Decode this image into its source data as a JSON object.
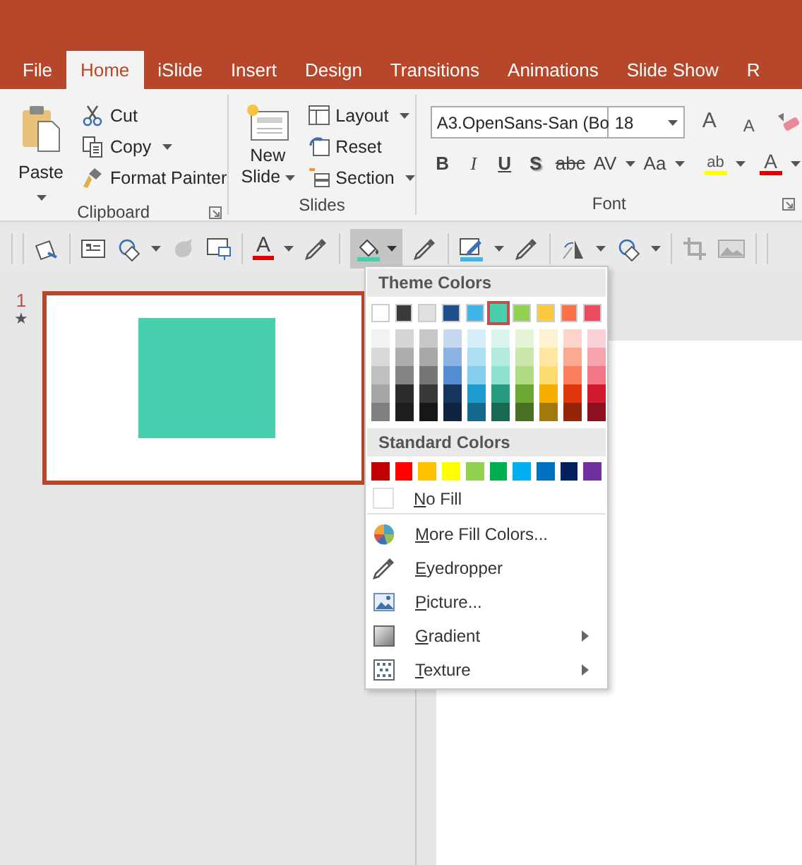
{
  "tabs": [
    {
      "label": "File",
      "selected": false
    },
    {
      "label": "Home",
      "selected": true
    },
    {
      "label": "iSlide",
      "selected": false
    },
    {
      "label": "Insert",
      "selected": false
    },
    {
      "label": "Design",
      "selected": false
    },
    {
      "label": "Transitions",
      "selected": false
    },
    {
      "label": "Animations",
      "selected": false
    },
    {
      "label": "Slide Show",
      "selected": false
    },
    {
      "label": "R",
      "selected": false
    }
  ],
  "ribbon": {
    "clipboard": {
      "label": "Clipboard",
      "paste": "Paste",
      "items": [
        {
          "kind": "cut",
          "label": "Cut"
        },
        {
          "kind": "copy",
          "label": "Copy"
        },
        {
          "kind": "painter",
          "label": "Format Painter"
        }
      ]
    },
    "slides": {
      "label": "Slides",
      "new_slide": "New",
      "new_slide_2": "Slide",
      "items": [
        {
          "kind": "layout",
          "label": "Layout"
        },
        {
          "kind": "reset",
          "label": "Reset"
        },
        {
          "kind": "section",
          "label": "Section"
        }
      ]
    },
    "font": {
      "label": "Font",
      "font_name": "A3.OpenSans-San (Bo",
      "font_size": "18",
      "size_buttons": [
        {
          "kind": "grow",
          "label": "A"
        },
        {
          "kind": "shrink",
          "label": "A"
        }
      ],
      "style_buttons": [
        {
          "kind": "bold",
          "label": "B"
        },
        {
          "kind": "italic",
          "label": "I"
        },
        {
          "kind": "underline",
          "label": "U"
        },
        {
          "kind": "shadow",
          "label": "S"
        },
        {
          "kind": "strike",
          "label": "abc"
        },
        {
          "kind": "spacing",
          "label": "AV"
        },
        {
          "kind": "case",
          "label": "Aa"
        }
      ],
      "highlight": "ab",
      "font_color": "A"
    }
  },
  "toolbar": {
    "font_color": "A"
  },
  "slides_pane": {
    "slides": [
      {
        "number": "1",
        "mark": "★",
        "selected": true
      }
    ]
  },
  "fill_menu": {
    "theme_title": "Theme Colors",
    "theme_colors": [
      {
        "color": "#ffffff",
        "selected": false,
        "shades": [
          {
            "color": "#f2f2f2"
          },
          {
            "color": "#d9d9d9"
          },
          {
            "color": "#bfbfbf"
          },
          {
            "color": "#a6a6a6"
          },
          {
            "color": "#808080"
          }
        ]
      },
      {
        "color": "#3a3a3a",
        "selected": false,
        "shades": [
          {
            "color": "#d6d6d6"
          },
          {
            "color": "#adadad"
          },
          {
            "color": "#858585"
          },
          {
            "color": "#2b2b2b"
          },
          {
            "color": "#1e1e1e"
          }
        ]
      },
      {
        "color": "#e0e0e0",
        "selected": false,
        "shades": [
          {
            "color": "#c8c8c8"
          },
          {
            "color": "#a8a8a8"
          },
          {
            "color": "#767676"
          },
          {
            "color": "#383838"
          },
          {
            "color": "#171717"
          }
        ]
      },
      {
        "color": "#1f4e8c",
        "selected": false,
        "shades": [
          {
            "color": "#c6d9f1"
          },
          {
            "color": "#8db3e2"
          },
          {
            "color": "#548dd4"
          },
          {
            "color": "#17365d"
          },
          {
            "color": "#0f243e"
          }
        ]
      },
      {
        "color": "#41b6e6",
        "selected": false,
        "shades": [
          {
            "color": "#d6eef9"
          },
          {
            "color": "#aedef3"
          },
          {
            "color": "#85cdec"
          },
          {
            "color": "#1e9ccf"
          },
          {
            "color": "#146a8c"
          }
        ]
      },
      {
        "color": "#47cfae",
        "selected": true,
        "shades": [
          {
            "color": "#d9f5ee"
          },
          {
            "color": "#b3ebde"
          },
          {
            "color": "#8ee1cd"
          },
          {
            "color": "#259b7f"
          },
          {
            "color": "#196955"
          }
        ]
      },
      {
        "color": "#92d050",
        "selected": false,
        "shades": [
          {
            "color": "#e5f3d6"
          },
          {
            "color": "#cbe7ad"
          },
          {
            "color": "#b1db85"
          },
          {
            "color": "#6ea834"
          },
          {
            "color": "#4a7023"
          }
        ]
      },
      {
        "color": "#fcc940",
        "selected": false,
        "shades": [
          {
            "color": "#fef3d0"
          },
          {
            "color": "#fee8a1"
          },
          {
            "color": "#fddd72"
          },
          {
            "color": "#f5ad00"
          },
          {
            "color": "#a3780c"
          }
        ]
      },
      {
        "color": "#f9704a",
        "selected": false,
        "shades": [
          {
            "color": "#fdd4c9"
          },
          {
            "color": "#fca993"
          },
          {
            "color": "#fb7e5d"
          },
          {
            "color": "#e0380c"
          },
          {
            "color": "#952508"
          }
        ]
      },
      {
        "color": "#e84c5d",
        "selected": false,
        "shades": [
          {
            "color": "#fad1d6"
          },
          {
            "color": "#f6a4ae"
          },
          {
            "color": "#f17686"
          },
          {
            "color": "#d21a30"
          },
          {
            "color": "#8c1120"
          }
        ]
      }
    ],
    "standard_title": "Standard Colors",
    "standard_colors": [
      {
        "color": "#c00000"
      },
      {
        "color": "#ff0000"
      },
      {
        "color": "#ffc000"
      },
      {
        "color": "#ffff00"
      },
      {
        "color": "#92d050"
      },
      {
        "color": "#00b050"
      },
      {
        "color": "#00b0f0"
      },
      {
        "color": "#0070c0"
      },
      {
        "color": "#002060"
      },
      {
        "color": "#7030a0"
      }
    ],
    "no_fill": "No Fill",
    "items": [
      {
        "kind": "palette",
        "label": "More Fill Colors...",
        "submenu": false
      },
      {
        "kind": "eyedropper",
        "label": "Eyedropper",
        "submenu": false
      },
      {
        "kind": "picture",
        "label": "Picture...",
        "submenu": false
      },
      {
        "kind": "gradient",
        "label": "Gradient",
        "submenu": true
      },
      {
        "kind": "texture",
        "label": "Texture",
        "submenu": true
      }
    ]
  }
}
